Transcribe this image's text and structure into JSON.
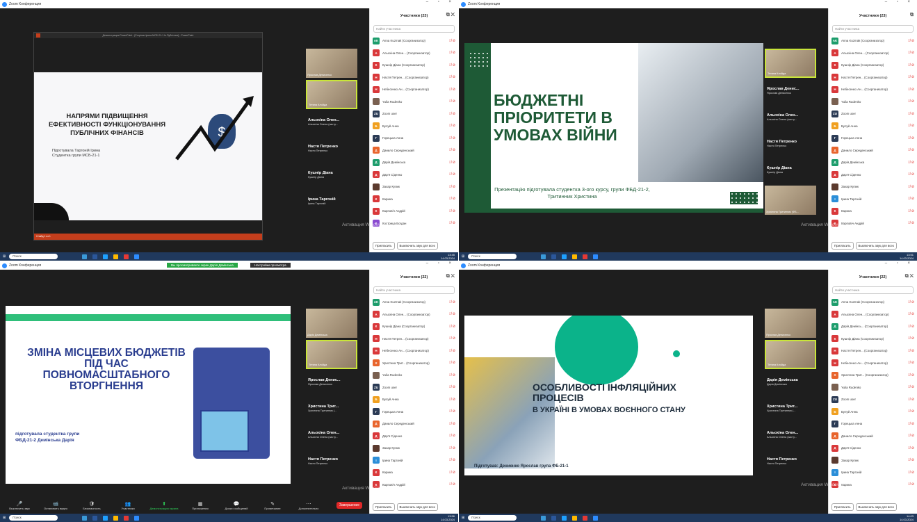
{
  "app_title": "Zoom Конференция",
  "taskbar": {
    "search": "Поиск",
    "lang": "УКР"
  },
  "footer": {
    "invite": "Пригласить",
    "mute_all": "Выключить звук для всех"
  },
  "search_placeholder": "Найти участника",
  "activation": "Активация Windows",
  "q0": {
    "participants_title": "Участники (23)",
    "time": "13:45",
    "date": "14.03.2024",
    "ppt_title": "Демонстрация PowerPoint - [Сторінки Ірина МСБ-21-1 Ін.Публічних] - PowerPoint",
    "ppt_status": "Слайд 1 из 1",
    "slide_title": "НАПРЯМИ ПІДВИЩЕННЯ ЕФЕКТИВНОСТІ ФУНКЦІОНУВАННЯ ПУБЛІЧНИХ ФІНАНСІВ",
    "slide_author": "Підготувала Таргоній Ірина",
    "slide_group": "Студентка групи МСБ-21-1",
    "tiles": [
      {
        "label": "Ярослав Денисенко",
        "face": true
      },
      {
        "label": "Тетяна Клойда",
        "face": true,
        "hl": true
      }
    ],
    "names": [
      {
        "name": "Альохіна Олен...",
        "sub": "Альохіна Олена (засту..."
      },
      {
        "name": "Настя Петренко",
        "sub": "Настя Петренко"
      },
      {
        "name": "Кушнір Діана",
        "sub": "Кушнір Діана"
      },
      {
        "name": "Ірина Таргоній",
        "sub": "Ірина Таргоній"
      }
    ],
    "participants": [
      {
        "ini": "AK",
        "c": "#1d9d6c",
        "n": "Anna Kuzmak (Соорганизатор)"
      },
      {
        "ini": "A",
        "c": "#d9383a",
        "n": "Альохіна Олен... (Соорганизатор)"
      },
      {
        "ini": "К",
        "c": "#d9383a",
        "n": "Кушнір Діана (Соорганизатор)"
      },
      {
        "ini": "Н",
        "c": "#d9383a",
        "n": "Настя Петрен... (Соорганизатор)"
      },
      {
        "ini": "Н",
        "c": "#d9383a",
        "n": "Небесенко Ан... (Соорганизатор)"
      },
      {
        "ini": "",
        "c": "#7a6050",
        "n": "Yulia Rudenko"
      },
      {
        "ini": "ZU",
        "c": "#2b3b55",
        "n": "Zoom user"
      },
      {
        "ini": "Б",
        "c": "#f0a020",
        "n": "Булуй Анна"
      },
      {
        "ini": "Г",
        "c": "#2b3b55",
        "n": "Горецька Анна"
      },
      {
        "ini": "Д",
        "c": "#e8642c",
        "n": "Данило Середенський"
      },
      {
        "ini": "Д",
        "c": "#1d9d6c",
        "n": "Дарія Демінська"
      },
      {
        "ini": "Д",
        "c": "#d9383a",
        "n": "Дар'я Сіденко"
      },
      {
        "ini": "",
        "c": "#5b3a2e",
        "n": "Захар Кулик"
      },
      {
        "ini": "К",
        "c": "#d9383a",
        "n": "Карина"
      },
      {
        "ini": "К",
        "c": "#d9383a",
        "n": "Карповіч Андрій"
      },
      {
        "ini": "К",
        "c": "#8a4ad0",
        "n": "Кострица Богдан"
      }
    ]
  },
  "q1": {
    "participants_title": "Участники (23)",
    "time": "13:51",
    "date": "14.03.2024",
    "slide_title": "БЮДЖЕТНІ ПРІОРИТЕТИ В УМОВАХ ВІЙНИ",
    "slide_caption": "Презентацію підготувала студентка 3-ого курсу, групи ФБД-21-2, Тритинник Христина",
    "tiles": [
      {
        "label": "Тетяна Клойда",
        "face": true,
        "hl": true
      }
    ],
    "names": [
      {
        "name": "Ярослав Денис...",
        "sub": "Ярослав Денисенко"
      },
      {
        "name": "Альохіна Олен...",
        "sub": "Альохіна Олена (засту..."
      },
      {
        "name": "Настя Петренко",
        "sub": "Настя Петренко"
      },
      {
        "name": "Кушнір Діана",
        "sub": "Кушнір Діана"
      }
    ],
    "bottom_tile": "Христина Тритинник (ФБ...",
    "participants": [
      {
        "ini": "AK",
        "c": "#1d9d6c",
        "n": "Anna Kuzmak (Соорганизатор)"
      },
      {
        "ini": "A",
        "c": "#d9383a",
        "n": "Альохіна Олен... (Соорганизатор)"
      },
      {
        "ini": "К",
        "c": "#d9383a",
        "n": "Кушнір Діана (Соорганизатор)"
      },
      {
        "ini": "Н",
        "c": "#d9383a",
        "n": "Настя Петрен... (Соорганизатор)"
      },
      {
        "ini": "Н",
        "c": "#d9383a",
        "n": "Небесенко Ан... (Соорганизатор)"
      },
      {
        "ini": "",
        "c": "#7a6050",
        "n": "Yulia Rudenko"
      },
      {
        "ini": "ZU",
        "c": "#2b3b55",
        "n": "Zoom user"
      },
      {
        "ini": "Б",
        "c": "#f0a020",
        "n": "Булуй Анна"
      },
      {
        "ini": "Г",
        "c": "#2b3b55",
        "n": "Горецька Анна"
      },
      {
        "ini": "Д",
        "c": "#e8642c",
        "n": "Данило Середенський"
      },
      {
        "ini": "Д",
        "c": "#1d9d6c",
        "n": "Дарія Демінська"
      },
      {
        "ini": "Д",
        "c": "#d9383a",
        "n": "Дар'я Сіденко"
      },
      {
        "ini": "",
        "c": "#5b3a2e",
        "n": "Захар Кулик"
      },
      {
        "ini": "І",
        "c": "#2b8ed8",
        "n": "Ірина Таргоній"
      },
      {
        "ini": "К",
        "c": "#d9383a",
        "n": "Карина"
      },
      {
        "ini": "К",
        "c": "#d9383a",
        "n": "Карповіч Андрій"
      }
    ]
  },
  "q2": {
    "participants_title": "Участники (22)",
    "time": "13:56",
    "date": "14.03.2024",
    "viewing_banner": "Вы просматриваете экран Дарія Демінська",
    "view_options": "Настройки просмотра",
    "slide_title": "ЗМІНА МІСЦЕВИХ БЮДЖЕТІВ ПІД ЧАС ПОВНОМАСШТАБНОГО ВТОРГНЕННЯ",
    "slide_author": "підготувала студентка групи ФБД-21-2 Демінська Дарія",
    "tiles": [
      {
        "label": "Дарія Демінська",
        "face": true
      },
      {
        "label": "Тетяна Клойда",
        "face": true,
        "hl": true
      }
    ],
    "names": [
      {
        "name": "Ярослав Денис...",
        "sub": "Ярослав Денисенко"
      },
      {
        "name": "Христина Трит...",
        "sub": "Христина Тритинник (..."
      },
      {
        "name": "Альохіна Олен...",
        "sub": "Альохіна Олена (засту..."
      },
      {
        "name": "Настя Петренко",
        "sub": "Настя Петренко"
      }
    ],
    "toolbar": [
      "Выключить звук",
      "Остановить видео",
      "Безопасность",
      "Участники",
      "Демонстрация экрана",
      "Приложения",
      "Доски сообщений",
      "Примечание",
      "Дополнительно"
    ],
    "end_button": "Завершение",
    "participants": [
      {
        "ini": "AK",
        "c": "#1d9d6c",
        "n": "Anna Kuzmak (Соорганизатор)"
      },
      {
        "ini": "A",
        "c": "#d9383a",
        "n": "Альохіна Олен... (Соорганизатор)"
      },
      {
        "ini": "К",
        "c": "#d9383a",
        "n": "Кушнір Діана (Соорганизатор)"
      },
      {
        "ini": "Н",
        "c": "#d9383a",
        "n": "Настя Петрен... (Соорганизатор)"
      },
      {
        "ini": "Н",
        "c": "#d9383a",
        "n": "Небесенко Ан... (Соорганизатор)"
      },
      {
        "ini": "Х",
        "c": "#e8642c",
        "n": "Христина Трит... (Соорганизатор)"
      },
      {
        "ini": "",
        "c": "#7a6050",
        "n": "Yulia Rudenko"
      },
      {
        "ini": "ZU",
        "c": "#2b3b55",
        "n": "Zoom user"
      },
      {
        "ini": "Б",
        "c": "#f0a020",
        "n": "Булуй Анна"
      },
      {
        "ini": "Г",
        "c": "#2b3b55",
        "n": "Горецька Анна"
      },
      {
        "ini": "Д",
        "c": "#e8642c",
        "n": "Данило Середенський"
      },
      {
        "ini": "Д",
        "c": "#d9383a",
        "n": "Дар'я Сіденко"
      },
      {
        "ini": "",
        "c": "#5b3a2e",
        "n": "Захар Кулик"
      },
      {
        "ini": "І",
        "c": "#2b8ed8",
        "n": "Ірина Таргоній"
      },
      {
        "ini": "К",
        "c": "#d9383a",
        "n": "Карина"
      },
      {
        "ini": "К",
        "c": "#d9383a",
        "n": "Карповіч Андрій"
      }
    ]
  },
  "q3": {
    "participants_title": "Участники (22)",
    "time": "14:03",
    "date": "14.03.2024",
    "slide_title1": "ОСОБЛИВОСТІ ІНФЛЯЦІЙНИХ ПРОЦЕСІВ",
    "slide_title2": "В УКРАЇНІ В УМОВАХ ВОЄННОГО СТАНУ",
    "slide_author": "Підготував: Дениенко Ярослав група ФБ-21-1",
    "tiles": [
      {
        "label": "Ярослав Денисенко",
        "face": true
      },
      {
        "label": "Тетяна Клойда",
        "face": true,
        "hl": true
      }
    ],
    "names": [
      {
        "name": "Дарія Демінська",
        "sub": "Дарія Демінська"
      },
      {
        "name": "Христина Трит...",
        "sub": "Христина Тритинник (..."
      },
      {
        "name": "Альохіна Олен...",
        "sub": "Альохіна Олена (засту..."
      },
      {
        "name": "Настя Петренко",
        "sub": "Настя Петренко"
      }
    ],
    "participants": [
      {
        "ini": "AK",
        "c": "#1d9d6c",
        "n": "Anna Kuzmak (Соорганизатор)"
      },
      {
        "ini": "A",
        "c": "#d9383a",
        "n": "Альохіна Олен... (Соорганизатор)"
      },
      {
        "ini": "Д",
        "c": "#1d9d6c",
        "n": "Дарія Демінсь... (Соорганизатор)"
      },
      {
        "ini": "К",
        "c": "#d9383a",
        "n": "Кушнір Діана (Соорганизатор)"
      },
      {
        "ini": "Н",
        "c": "#d9383a",
        "n": "Настя Петрен... (Соорганизатор)"
      },
      {
        "ini": "Н",
        "c": "#d9383a",
        "n": "Небесенко Ан... (Соорганизатор)"
      },
      {
        "ini": "Х",
        "c": "#e8642c",
        "n": "Христина Трит... (Соорганизатор)"
      },
      {
        "ini": "",
        "c": "#7a6050",
        "n": "Yulia Rudenko"
      },
      {
        "ini": "ZU",
        "c": "#2b3b55",
        "n": "Zoom user"
      },
      {
        "ini": "Б",
        "c": "#f0a020",
        "n": "Булуй Анна"
      },
      {
        "ini": "Г",
        "c": "#2b3b55",
        "n": "Горецька Анна"
      },
      {
        "ini": "Д",
        "c": "#e8642c",
        "n": "Данило Середенський"
      },
      {
        "ini": "Д",
        "c": "#d9383a",
        "n": "Дар'я Сіденко"
      },
      {
        "ini": "",
        "c": "#5b3a2e",
        "n": "Захар Кулик"
      },
      {
        "ini": "І",
        "c": "#2b8ed8",
        "n": "Ірина Таргоній"
      },
      {
        "ini": "К",
        "c": "#d9383a",
        "n": "Карина"
      }
    ]
  }
}
